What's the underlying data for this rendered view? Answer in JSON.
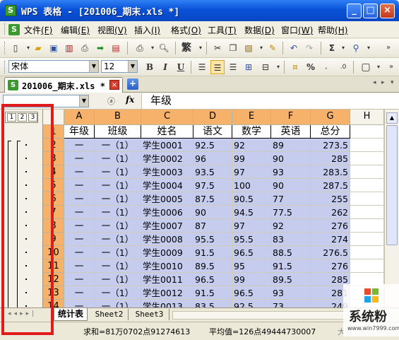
{
  "window": {
    "title": "WPS 表格 - [201006_期末.xls *]",
    "app_icon": "S",
    "buttons": [
      "_",
      "□",
      "×"
    ]
  },
  "menu": [
    {
      "label": "文件",
      "key": "(F)"
    },
    {
      "label": "编辑",
      "key": "(E)"
    },
    {
      "label": "视图",
      "key": "(V)"
    },
    {
      "label": "插入",
      "key": "(I)"
    },
    {
      "label": "格式",
      "key": "(O)"
    },
    {
      "label": "工具",
      "key": "(T)"
    },
    {
      "label": "数据",
      "key": "(D)"
    },
    {
      "label": "窗口",
      "key": "(W)"
    },
    {
      "label": "帮助",
      "key": "(H)"
    }
  ],
  "toolbar1": {
    "icons": [
      "new-icon",
      "open-icon",
      "save-icon",
      "permission-icon",
      "print-icon",
      "export-icon",
      "pdf-icon",
      "print-preview-icon",
      "zoom-icon",
      "traditional-icon",
      "cut-icon",
      "copy-icon",
      "paste-icon",
      "format-painter-icon",
      "undo-icon",
      "redo-icon",
      "sum-icon",
      "filter-icon"
    ],
    "sigma": "Σ",
    "traditional": "繁"
  },
  "toolbar2": {
    "font": "宋体",
    "size": "12",
    "bold": "B",
    "italic": "I",
    "underline": "U",
    "icons": [
      "align-left-icon",
      "align-center-icon",
      "align-right-icon",
      "merge-icon",
      "currency-icon",
      "percent-icon",
      "decimal-icon",
      "border-icon"
    ]
  },
  "tab": {
    "name": "201006_期末.xls *",
    "add": "+"
  },
  "formula": {
    "fx": "fx",
    "content": "年级"
  },
  "outline_levels": [
    "1",
    "2",
    "3"
  ],
  "columns": [
    "A",
    "B",
    "C",
    "D",
    "E",
    "F",
    "G",
    "H"
  ],
  "rows": [
    {
      "n": "1",
      "cells": [
        "年级",
        "班级",
        "姓名",
        "语文",
        "数学",
        "英语",
        "总分"
      ]
    },
    {
      "n": "2",
      "cells": [
        "一",
        "一（1）",
        "学生0001",
        "92.5",
        "92",
        "89",
        "273.5"
      ]
    },
    {
      "n": "3",
      "cells": [
        "一",
        "一（1）",
        "学生0002",
        "96",
        "99",
        "90",
        "285"
      ]
    },
    {
      "n": "4",
      "cells": [
        "一",
        "一（1）",
        "学生0003",
        "93.5",
        "97",
        "93",
        "283.5"
      ]
    },
    {
      "n": "5",
      "cells": [
        "一",
        "一（1）",
        "学生0004",
        "97.5",
        "100",
        "90",
        "287.5"
      ]
    },
    {
      "n": "6",
      "cells": [
        "一",
        "一（1）",
        "学生0005",
        "87.5",
        "90.5",
        "77",
        "255"
      ]
    },
    {
      "n": "7",
      "cells": [
        "一",
        "一（1）",
        "学生0006",
        "90",
        "94.5",
        "77.5",
        "262"
      ]
    },
    {
      "n": "8",
      "cells": [
        "一",
        "一（1）",
        "学生0007",
        "87",
        "97",
        "92",
        "276"
      ]
    },
    {
      "n": "9",
      "cells": [
        "一",
        "一（1）",
        "学生0008",
        "95.5",
        "95.5",
        "83",
        "274"
      ]
    },
    {
      "n": "10",
      "cells": [
        "一",
        "一（1）",
        "学生0009",
        "91.5",
        "96.5",
        "88.5",
        "276.5"
      ]
    },
    {
      "n": "11",
      "cells": [
        "一",
        "一（1）",
        "学生0010",
        "89.5",
        "95",
        "91.5",
        "276"
      ]
    },
    {
      "n": "12",
      "cells": [
        "一",
        "一（1）",
        "学生0011",
        "96.5",
        "99",
        "89.5",
        "285"
      ]
    },
    {
      "n": "13",
      "cells": [
        "一",
        "一（1）",
        "学生0012",
        "91.5",
        "96.5",
        "93",
        "281"
      ]
    },
    {
      "n": "14",
      "cells": [
        "一",
        "一（1）",
        "学生0013",
        "83.5",
        "92.5",
        "73",
        "249"
      ]
    }
  ],
  "sheets": [
    "统计表",
    "Sheet2",
    "Sheet3"
  ],
  "status": {
    "sum": "求和=81万0702点91274613",
    "avg": "平均值=126点49444730007",
    "extra": "大写"
  },
  "watermark": {
    "text": "系统粉",
    "url": "www.win7999.com"
  },
  "colors": {
    "selection": "#c5ccee",
    "selected_header": "#f6b26b",
    "highlight_box": "#e11b1b"
  }
}
